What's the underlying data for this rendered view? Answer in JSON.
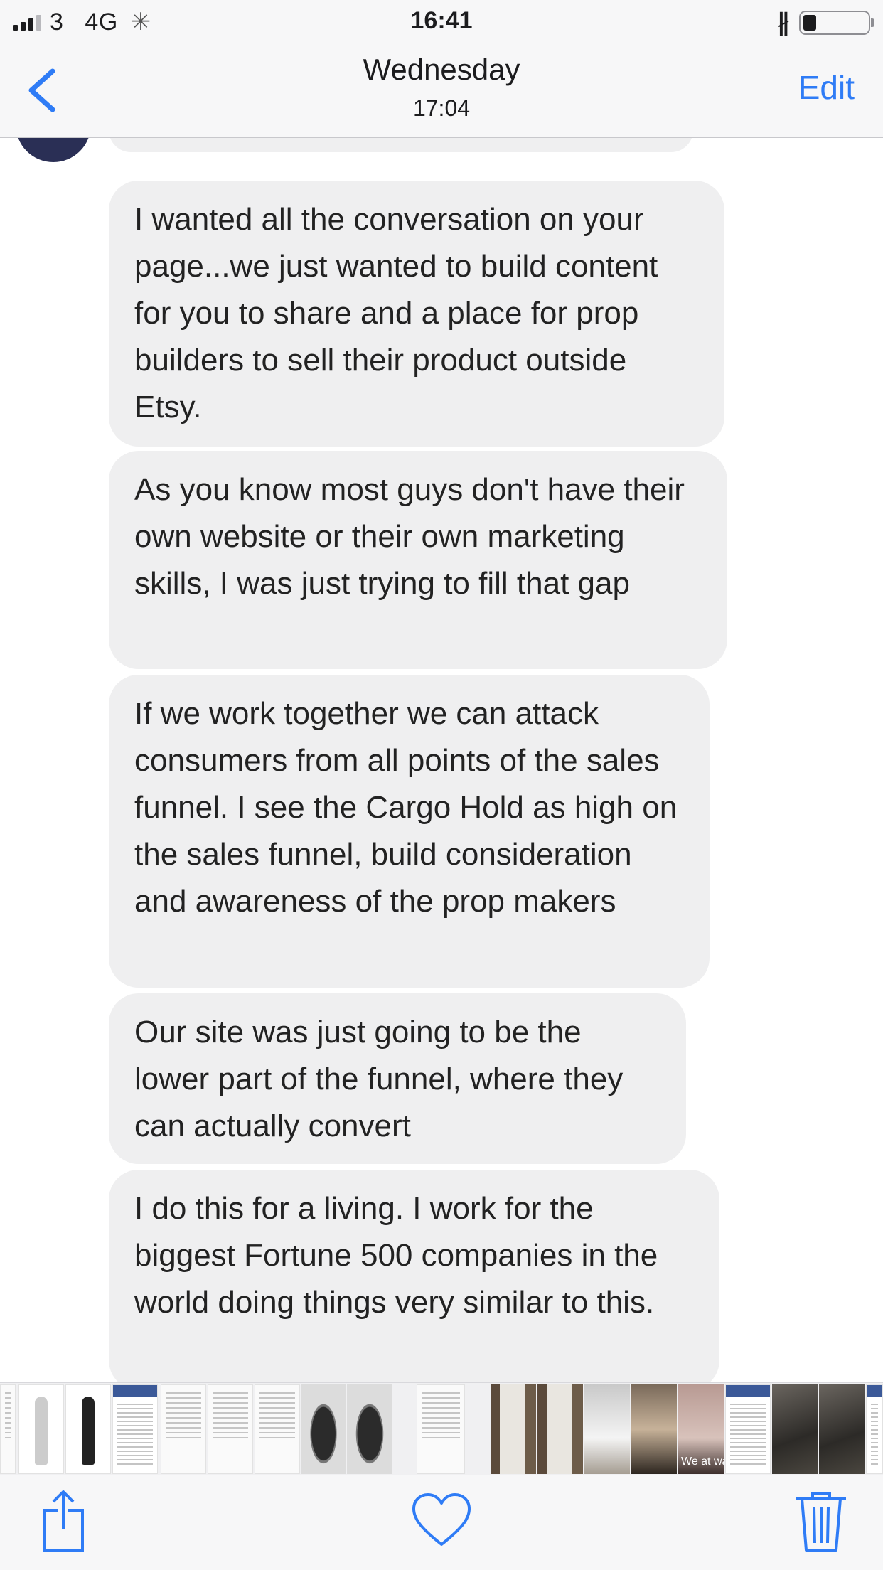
{
  "status_bar": {
    "carrier": "3",
    "network": "4G",
    "time": "16:41",
    "battery_percent": 20
  },
  "nav": {
    "title": "Wednesday",
    "subtitle": "17:04",
    "edit_label": "Edit",
    "accent_color": "#2f7cf6"
  },
  "messages": [
    "I wanted all the conversation on your page...we just wanted to build content for you to share and a place for prop builders to sell their product outside Etsy.",
    "As you know most guys don't have their own website or their own marketing skills, I was just trying to fill that gap",
    "If we work together we can attack consumers from all points of the sales funnel. I see the Cargo Hold as high on the sales funnel, build consideration and awareness of the prop makers",
    "Our site was just going to be the lower part of the funnel, where they can actually convert",
    "I do this for a living.  I work for the biggest Fortune 500 companies in the world doing things very similar to this."
  ],
  "thumbnail_strip": {
    "caption": "We at war"
  },
  "toolbar": {
    "share_icon": "share-icon",
    "favorite_icon": "heart-icon",
    "delete_icon": "trash-icon"
  }
}
